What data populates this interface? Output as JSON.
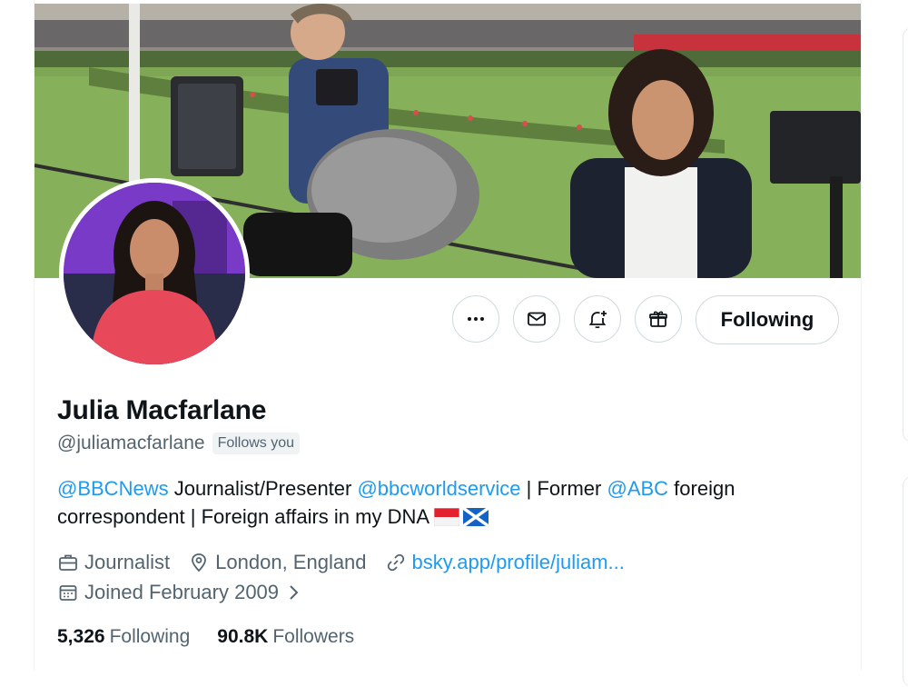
{
  "profile": {
    "name": "Julia Macfarlane",
    "handle": "@juliamacfarlane",
    "follows_you": "Follows you",
    "bio": {
      "mention1": "@BBCNews",
      "text1": " Journalist/Presenter ",
      "mention2": "@bbcworldservice",
      "text2": " | Former ",
      "mention3": "@ABC",
      "text3": " foreign correspondent | Foreign affairs in my DNA "
    },
    "occupation": "Journalist",
    "location": "London, England",
    "website": "bsky.app/profile/juliam...",
    "joined": "Joined February 2009",
    "stats": {
      "following_count": "5,326",
      "following_label": "Following",
      "followers_count": "90.8K",
      "followers_label": "Followers"
    }
  },
  "actions": {
    "more_icon": "more-horizontal-icon",
    "message_icon": "envelope-icon",
    "notify_icon": "bell-plus-icon",
    "subscribe_icon": "gift-icon",
    "follow_label": "Following"
  },
  "colors": {
    "accent": "#1d9bf0",
    "text": "#0f1419",
    "muted": "#536471",
    "border": "#cfd9de"
  }
}
